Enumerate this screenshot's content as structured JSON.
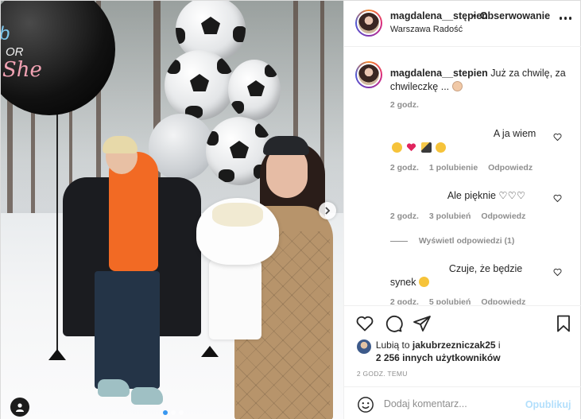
{
  "post": {
    "username": "magdalena__stępien",
    "separator": "•",
    "follow_status": "Obserwowanie",
    "location": "Warszawa Radość",
    "photo": {
      "balloon_text_boy": "b",
      "balloon_text_or": "OR",
      "balloon_text_she": "She"
    }
  },
  "caption": {
    "username": "magdalena__stepien",
    "text": "Już za chwilę, za chwileczkę ...",
    "time": "2 godz."
  },
  "comments": [
    {
      "text": "A ja wiem",
      "time": "2 godz.",
      "likes": "1 polubienie",
      "reply": "Odpowiedz"
    },
    {
      "text": "Ale pięknie ♡♡♡",
      "time": "2 godz.",
      "likes": "3 polubień",
      "reply": "Odpowiedz"
    },
    {
      "view_replies": "Wyświetl odpowiedzi (1)"
    },
    {
      "text_line1": "Czuje, że będzie",
      "text_line2": "synek",
      "time": "2 godz.",
      "likes": "5 polubień",
      "reply": "Odpowiedz"
    }
  ],
  "likes": {
    "prefix": "Lubią to",
    "user": "jakubrzezniczak25",
    "suffix": "i",
    "others": "2 256 innych użytkowników"
  },
  "time_ago": "2 GODZ. TEMU",
  "comment_box": {
    "placeholder": "Dodaj komentarz...",
    "publish": "Opublikuj"
  },
  "colors": {
    "accent": "#0095f6",
    "publish_disabled": "#b2dffc",
    "muted": "#8e8e8e",
    "text": "#262626"
  },
  "icons": [
    "more-icon",
    "heart-icon",
    "comment-icon",
    "share-icon",
    "bookmark-icon",
    "smile-icon",
    "chevron-right-icon",
    "tag-user-icon"
  ]
}
